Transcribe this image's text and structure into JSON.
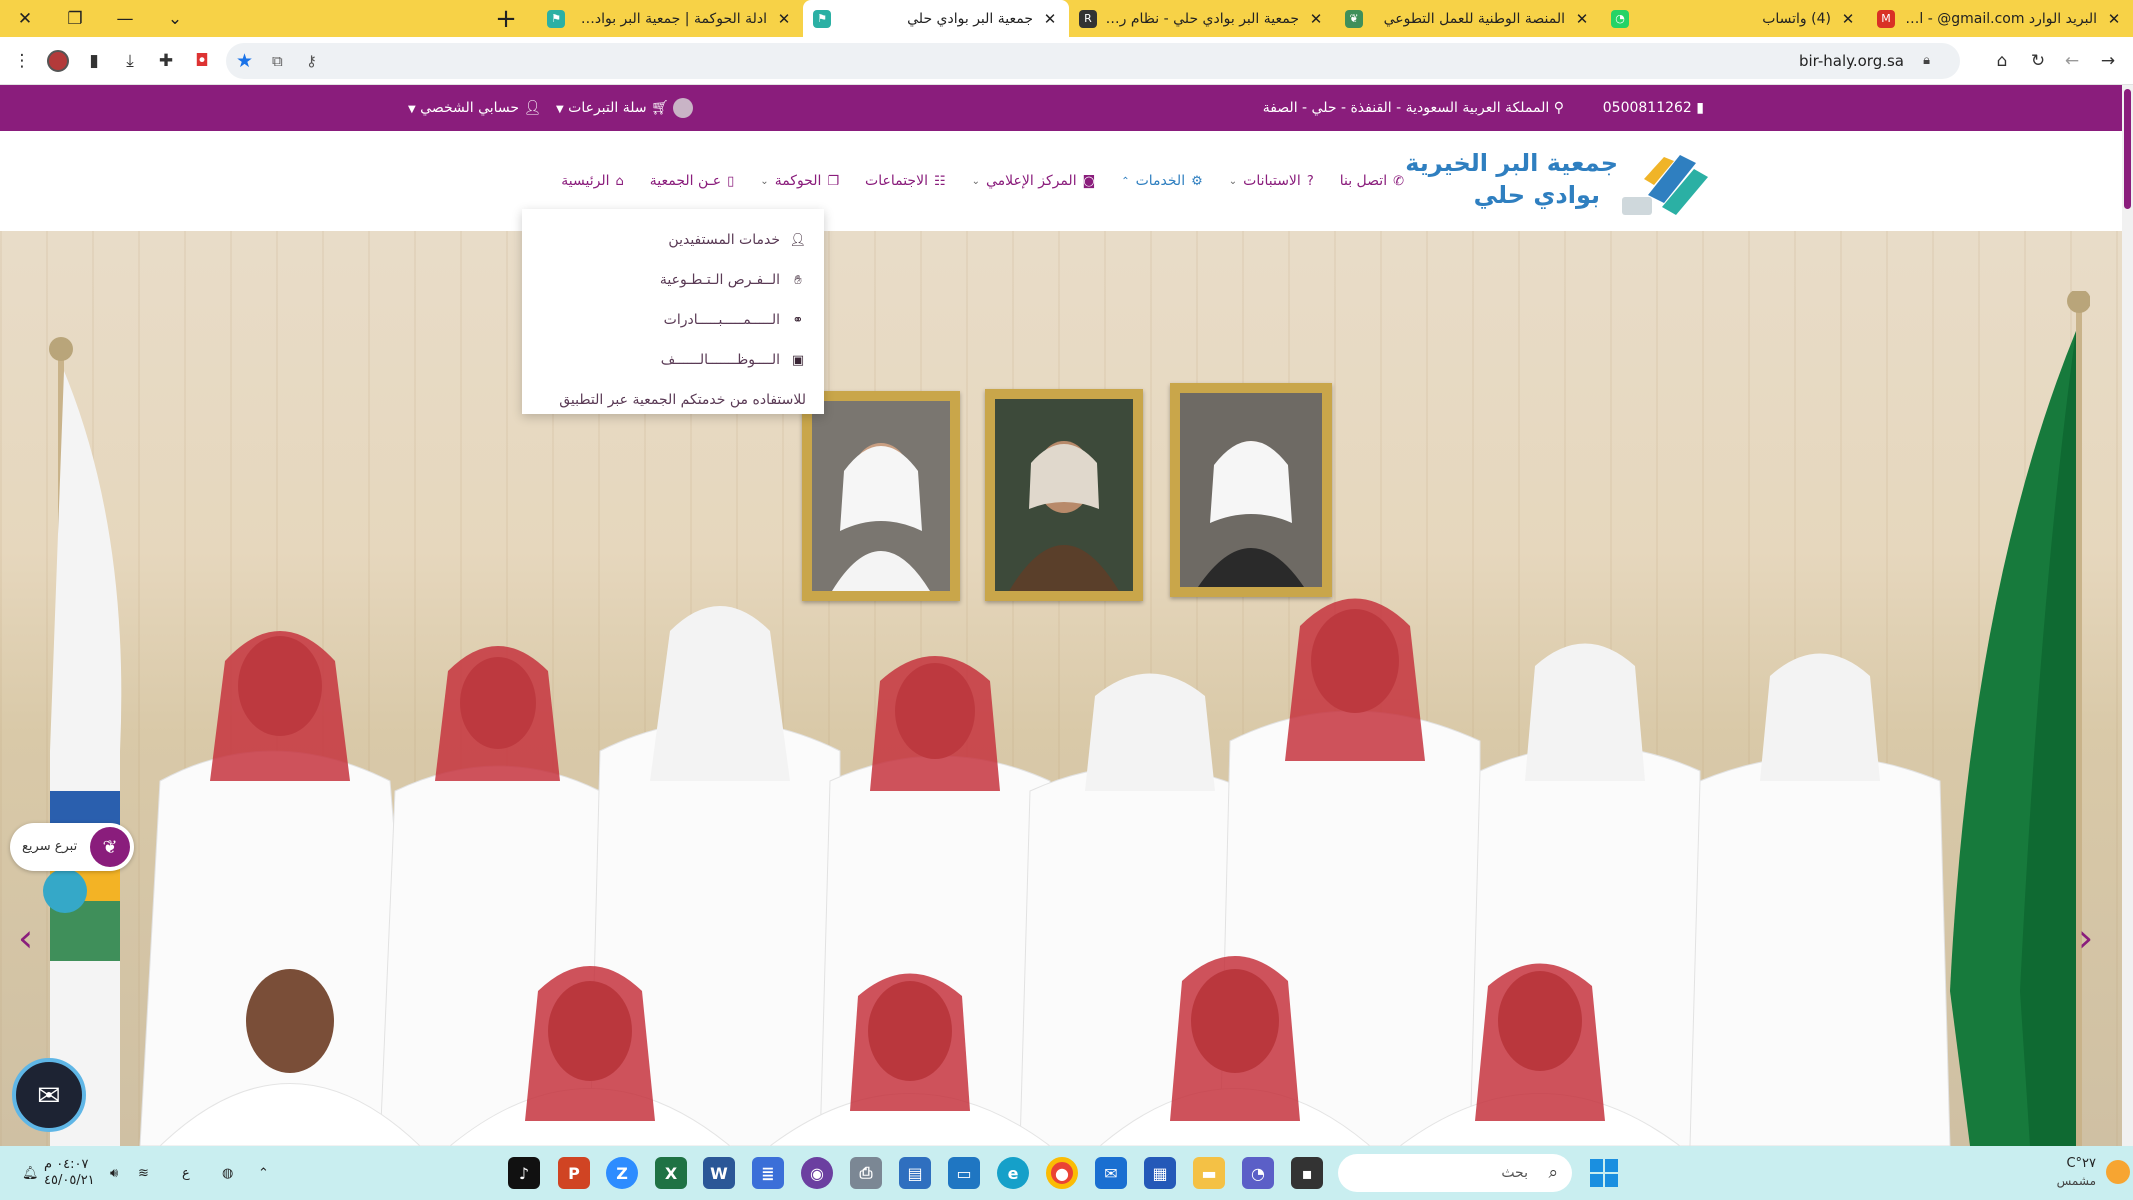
{
  "browser": {
    "tabs": [
      {
        "title": "البريد الوارد Gmail - @gmail.com",
        "favicon": "gmail-icon",
        "active": false
      },
      {
        "title": "(4) واتساب",
        "favicon": "whatsapp-icon",
        "active": false
      },
      {
        "title": "المنصة الوطنية للعمل التطوعي",
        "favicon": "volunteer-icon",
        "active": false
      },
      {
        "title": "جمعية البر بوادي حلي - نظام رافد",
        "favicon": "rafed-icon",
        "active": false
      },
      {
        "title": "جمعية البر بوادي حلي",
        "favicon": "site-icon",
        "active": true
      },
      {
        "title": "ادلة الحوكمة | جمعية البر بوادي حلي",
        "favicon": "site-icon",
        "active": false
      }
    ],
    "url": "bir-haly.org.sa"
  },
  "topbar": {
    "phone": "0500811262",
    "location": "المملكة العربية السعودية - القنفذة - حلي - الصفة",
    "cart_label": "سلة التبرعات",
    "account_label": "حسابي الشخصي"
  },
  "logo": {
    "line1": "جمعية البر الخيرية",
    "line2": "بوادي حلي"
  },
  "nav": {
    "items": [
      {
        "label": "الرئيسية",
        "icon": "home-icon",
        "has_dropdown": false
      },
      {
        "label": "عـن الجمعية",
        "icon": "bookmark-icon",
        "has_dropdown": false
      },
      {
        "label": "الحوكمة",
        "icon": "copy-icon",
        "has_dropdown": true
      },
      {
        "label": "الاجتماعات",
        "icon": "users-icon",
        "has_dropdown": false
      },
      {
        "label": "المركز الإعلامي",
        "icon": "camera-icon",
        "has_dropdown": true
      },
      {
        "label": "الخدمات",
        "icon": "services-icon",
        "has_dropdown": true,
        "open": true
      },
      {
        "label": "الاستبانات",
        "icon": "question-icon",
        "has_dropdown": true
      },
      {
        "label": "اتصل بنا",
        "icon": "phone-icon",
        "has_dropdown": false
      }
    ]
  },
  "services_dropdown": {
    "items": [
      {
        "label": "خدمات المستفيدين",
        "icon": "user-plus-icon"
      },
      {
        "label": "الــفـرص الـتـطـوعية",
        "icon": "hand-icon"
      },
      {
        "label": "الـــــمـــــبـــــادرات",
        "icon": "handshake-icon"
      },
      {
        "label": "الــــوظـــــــالــــــف",
        "icon": "briefcase-icon"
      },
      {
        "label": "للاستفاده من خدمتكم الجمعية عبر التطبيق",
        "icon": ""
      }
    ]
  },
  "hero": {
    "quick_donate_label": "تبرع سريع"
  },
  "taskbar": {
    "search_placeholder": "بحث",
    "time": "٠٤:٠٧ م",
    "date": "٤٥/٠٥/٢١",
    "lang": "ع",
    "temperature": "٢٧°C",
    "weather": "مشمس"
  },
  "colors": {
    "brand": "#8a1d7c",
    "accent": "#2f7fc0",
    "tabstrip": "#f7d247",
    "taskbar": "#c9eef0"
  }
}
